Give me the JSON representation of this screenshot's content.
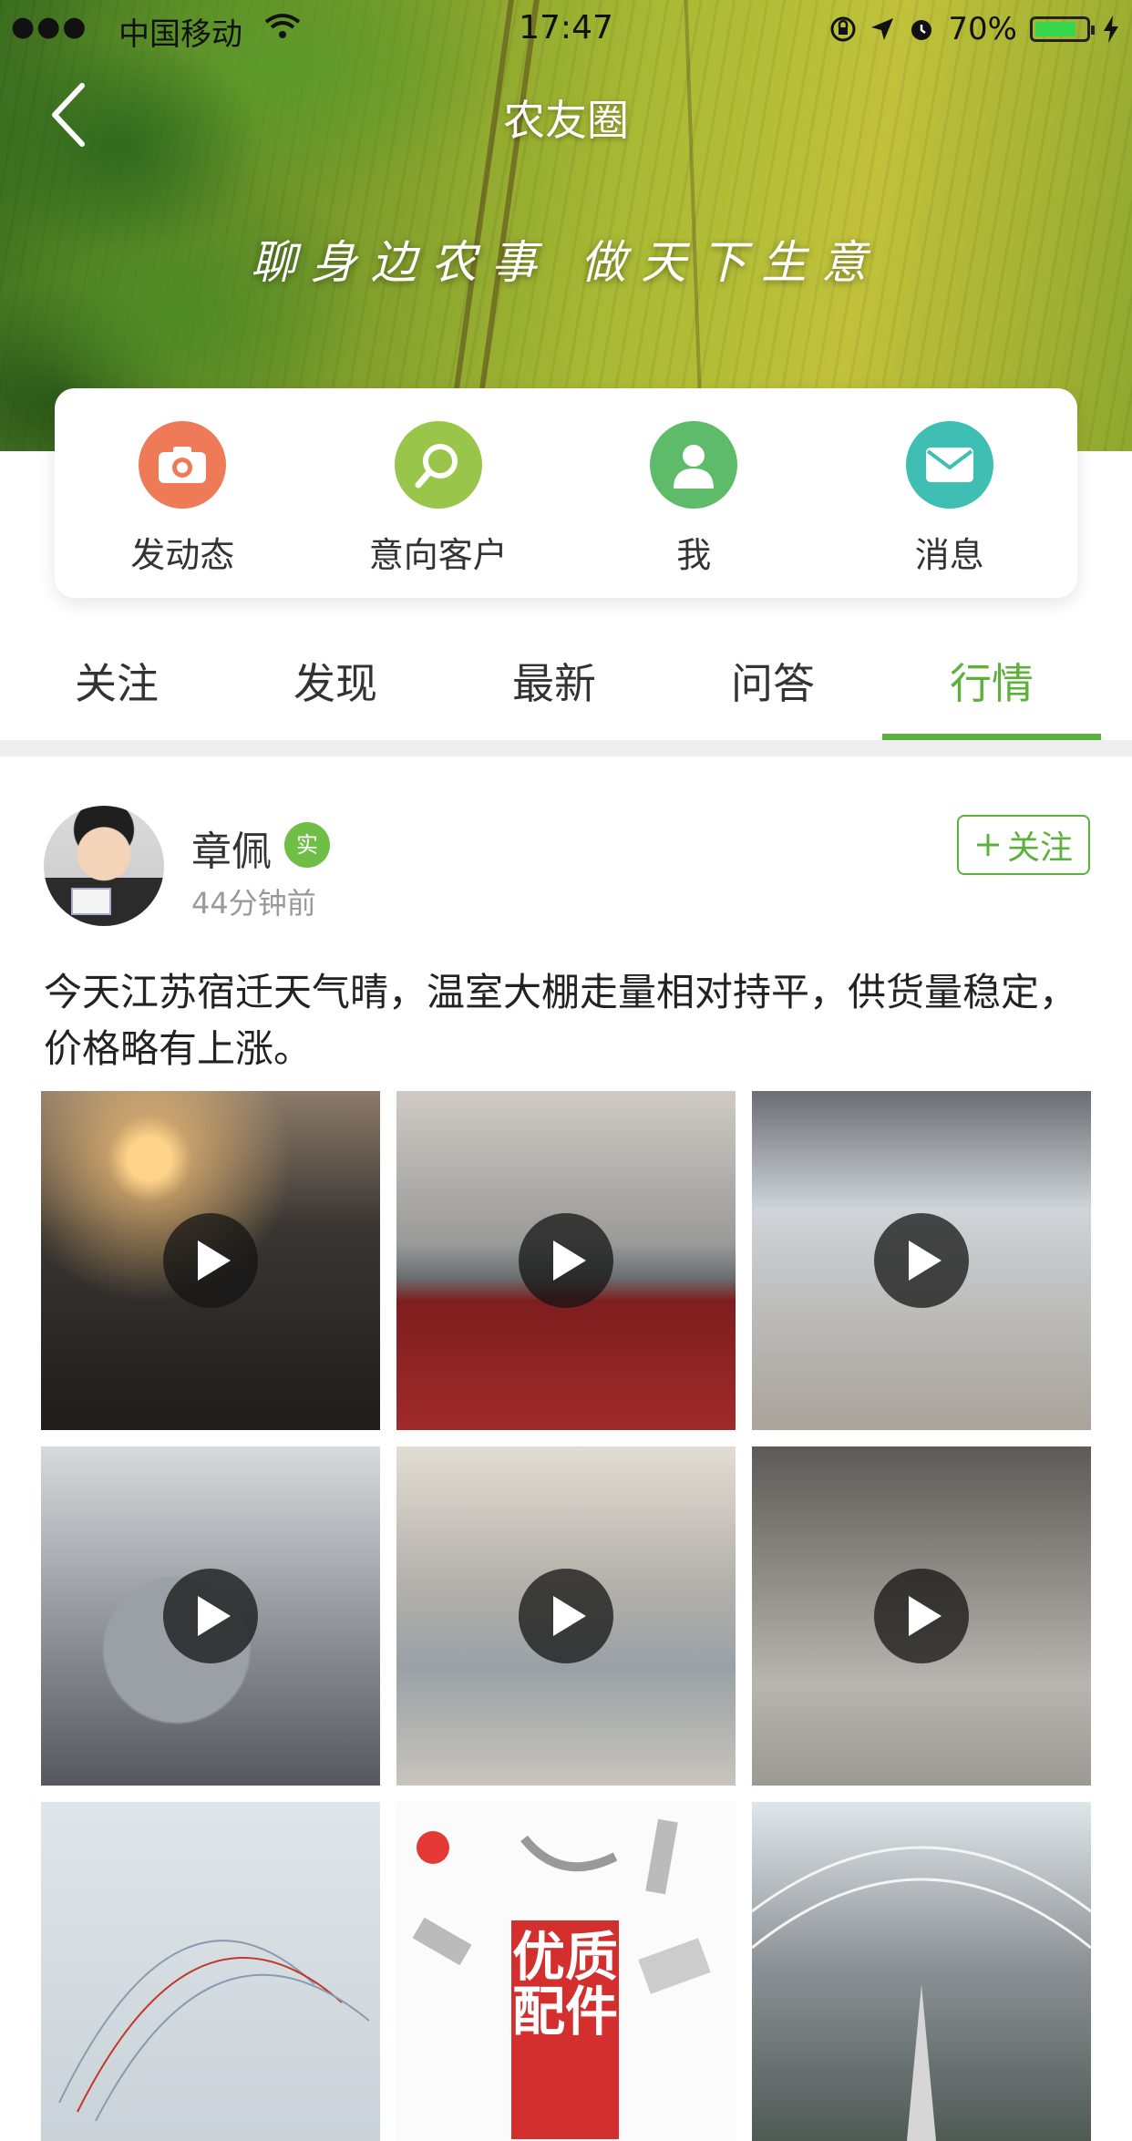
{
  "status_bar": {
    "signal": "●●●",
    "carrier": "中国移动",
    "time": "17:47",
    "battery": "70%"
  },
  "header": {
    "title": "农友圈",
    "slogan": "聊身边农事 做天下生意"
  },
  "actions": [
    {
      "label": "发动态",
      "icon": "camera-icon",
      "color": "#ef7a58"
    },
    {
      "label": "意向客户",
      "icon": "search-icon",
      "color": "#99c54a"
    },
    {
      "label": "我",
      "icon": "user-icon",
      "color": "#5dbb69"
    },
    {
      "label": "消息",
      "icon": "mail-icon",
      "color": "#3fbfb4"
    }
  ],
  "tabs": [
    {
      "label": "关注",
      "active": false
    },
    {
      "label": "发现",
      "active": false
    },
    {
      "label": "最新",
      "active": false
    },
    {
      "label": "问答",
      "active": false
    },
    {
      "label": "行情",
      "active": true
    }
  ],
  "accent_color": "#5bb13a",
  "post": {
    "user_name": "章佩",
    "verified_badge": "实",
    "time_ago": "44分钟前",
    "follow_label": "关注",
    "text": "今天江苏宿迁天气晴，温室大棚走量相对持平，供货量稳定，价格略有上涨。",
    "media": [
      {
        "type": "video"
      },
      {
        "type": "video"
      },
      {
        "type": "video"
      },
      {
        "type": "video"
      },
      {
        "type": "video"
      },
      {
        "type": "video"
      },
      {
        "type": "image"
      },
      {
        "type": "image",
        "caption": "优质配件"
      },
      {
        "type": "image"
      }
    ]
  }
}
